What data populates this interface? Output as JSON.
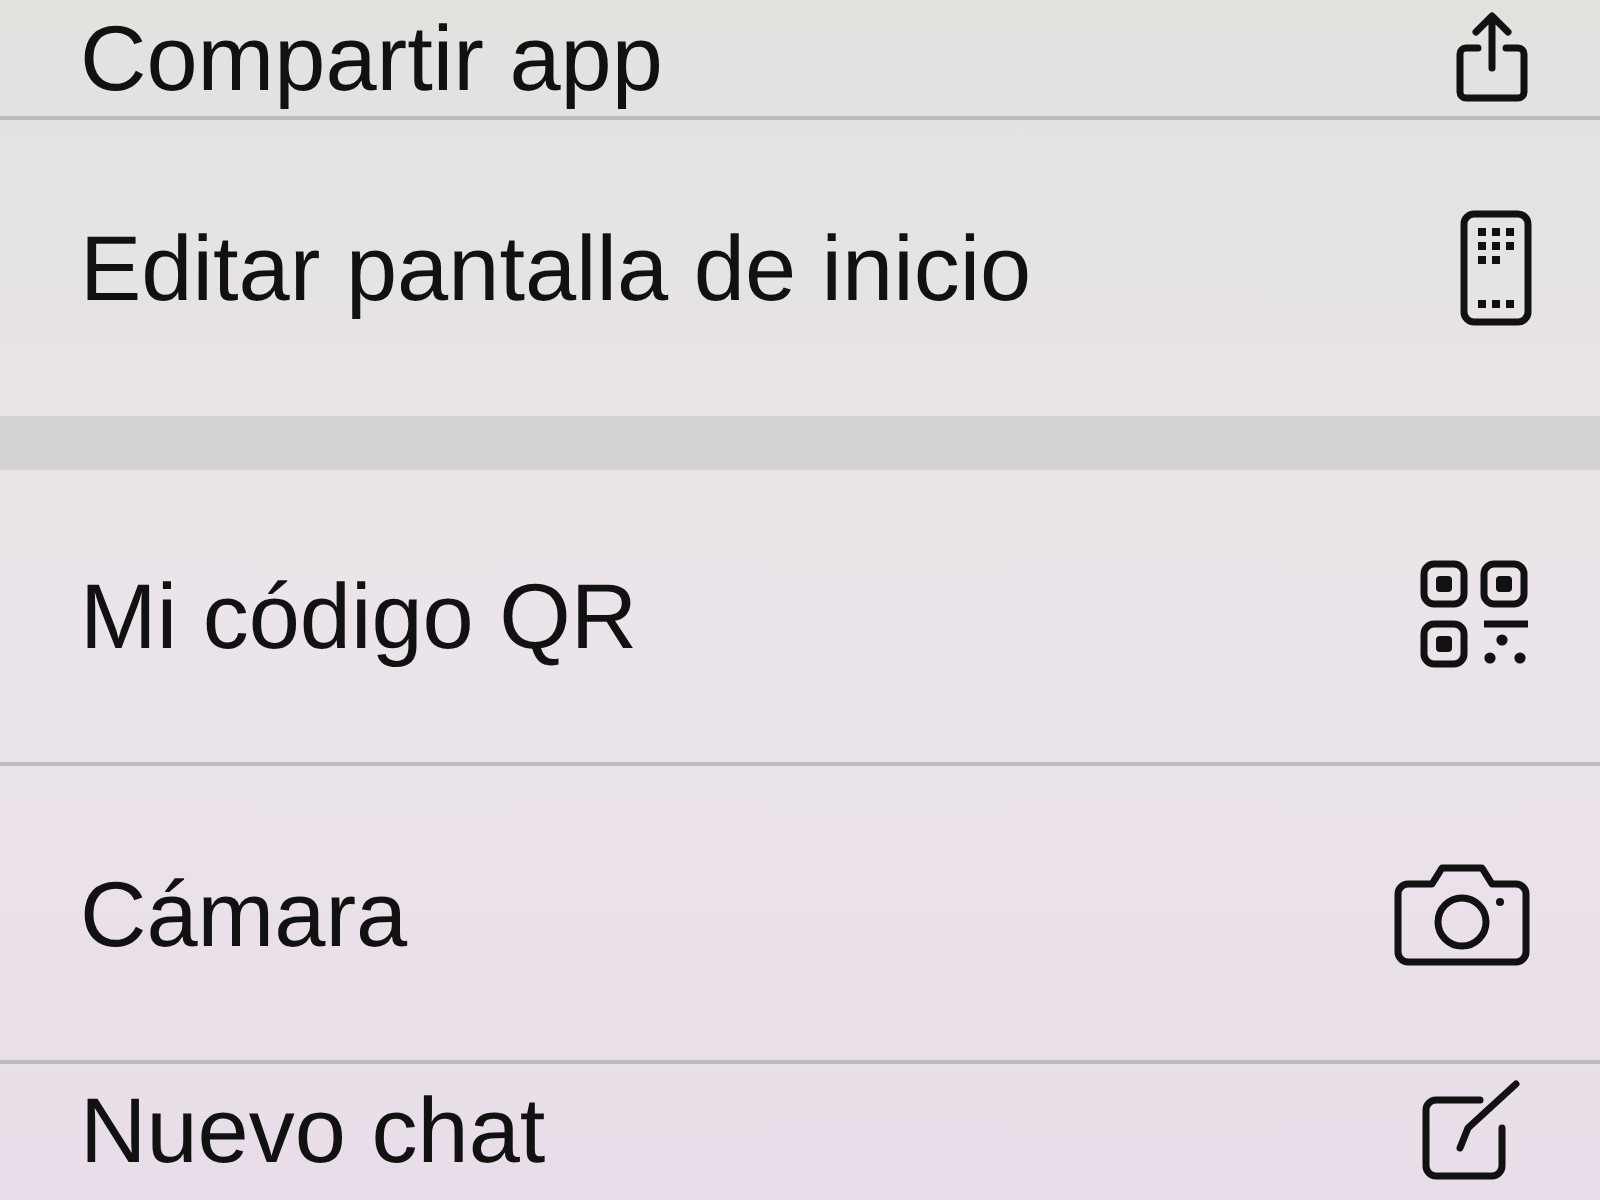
{
  "menu": {
    "groups": [
      {
        "items": [
          {
            "label": "Compartir app"
          },
          {
            "label": "Editar pantalla de inicio"
          }
        ]
      },
      {
        "items": [
          {
            "label": "Mi código QR"
          },
          {
            "label": "Cámara"
          },
          {
            "label": "Nuevo chat"
          }
        ]
      }
    ]
  }
}
